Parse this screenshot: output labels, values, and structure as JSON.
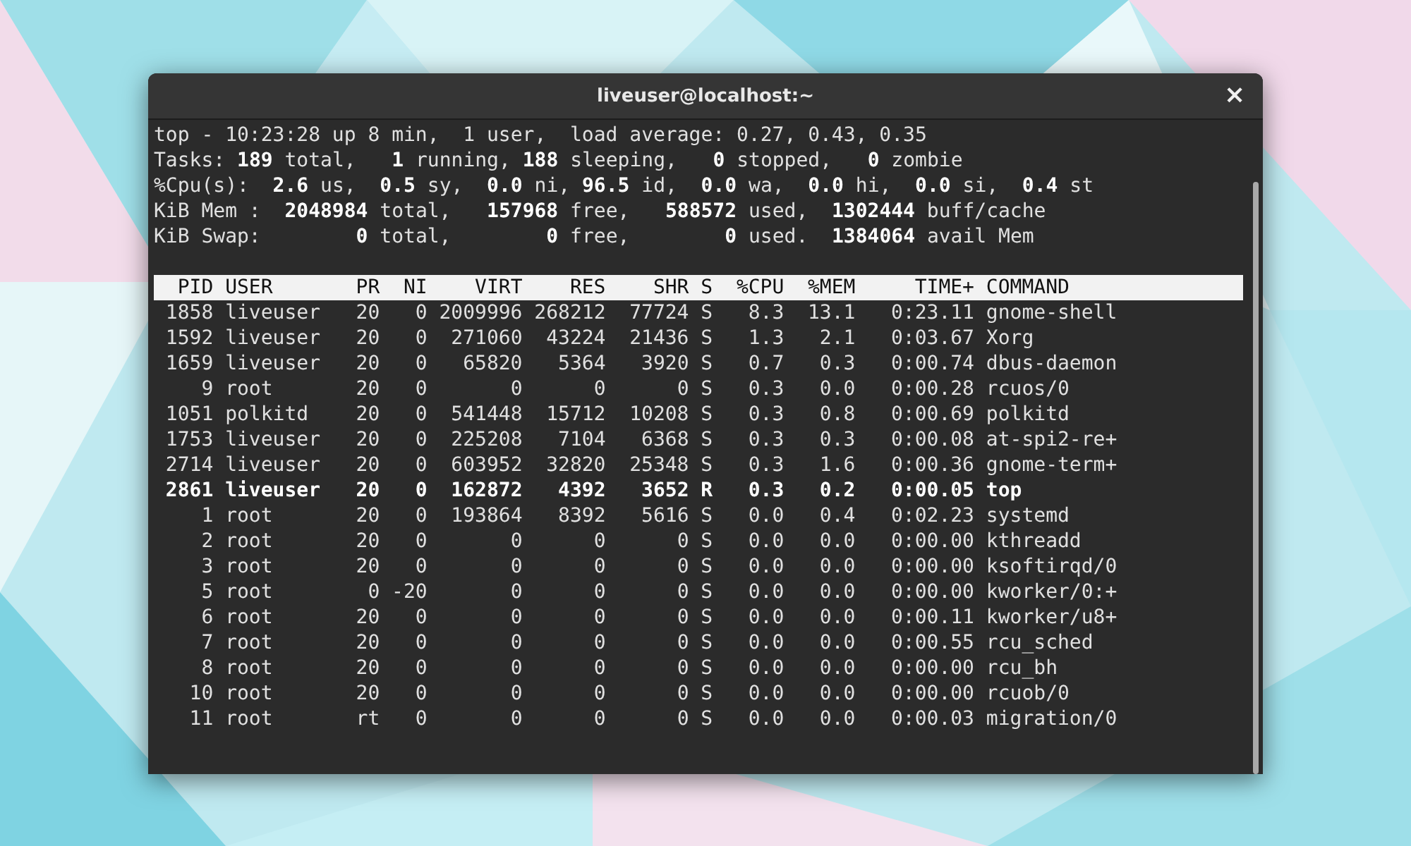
{
  "window": {
    "title": "liveuser@localhost:~",
    "close": "×"
  },
  "summary": [
    "top - 10:23:28 up 8 min,  1 user,  load average: 0.27, 0.43, 0.35",
    "Tasks: **189** total,   **1** running, **188** sleeping,   **0** stopped,   **0** zombie",
    "%Cpu(s):  **2.6** us,  **0.5** sy,  **0.0** ni, **96.5** id,  **0.0** wa,  **0.0** hi,  **0.0** si,  **0.4** st",
    "KiB Mem :  **2048984** total,   **157968** free,   **588572** used,  **1302444** buff/cache",
    "KiB Swap:        **0** total,        **0** free,        **0** used.  **1384064** avail Mem"
  ],
  "table": {
    "columns": [
      "PID",
      "USER",
      "PR",
      "NI",
      "VIRT",
      "RES",
      "SHR",
      "S",
      "%CPU",
      "%MEM",
      "TIME+",
      "COMMAND"
    ],
    "rows": [
      {
        "cells": [
          "1858",
          "liveuser",
          "20",
          "0",
          "2009996",
          "268212",
          "77724",
          "S",
          "8.3",
          "13.1",
          "0:23.11",
          "gnome-shell"
        ],
        "highlighted": false
      },
      {
        "cells": [
          "1592",
          "liveuser",
          "20",
          "0",
          "271060",
          "43224",
          "21436",
          "S",
          "1.3",
          "2.1",
          "0:03.67",
          "Xorg"
        ],
        "highlighted": false
      },
      {
        "cells": [
          "1659",
          "liveuser",
          "20",
          "0",
          "65820",
          "5364",
          "3920",
          "S",
          "0.7",
          "0.3",
          "0:00.74",
          "dbus-daemon"
        ],
        "highlighted": false
      },
      {
        "cells": [
          "9",
          "root",
          "20",
          "0",
          "0",
          "0",
          "0",
          "S",
          "0.3",
          "0.0",
          "0:00.28",
          "rcuos/0"
        ],
        "highlighted": false
      },
      {
        "cells": [
          "1051",
          "polkitd",
          "20",
          "0",
          "541448",
          "15712",
          "10208",
          "S",
          "0.3",
          "0.8",
          "0:00.69",
          "polkitd"
        ],
        "highlighted": false
      },
      {
        "cells": [
          "1753",
          "liveuser",
          "20",
          "0",
          "225208",
          "7104",
          "6368",
          "S",
          "0.3",
          "0.3",
          "0:00.08",
          "at-spi2-re+"
        ],
        "highlighted": false
      },
      {
        "cells": [
          "2714",
          "liveuser",
          "20",
          "0",
          "603952",
          "32820",
          "25348",
          "S",
          "0.3",
          "1.6",
          "0:00.36",
          "gnome-term+"
        ],
        "highlighted": false
      },
      {
        "cells": [
          "2861",
          "liveuser",
          "20",
          "0",
          "162872",
          "4392",
          "3652",
          "R",
          "0.3",
          "0.2",
          "0:00.05",
          "top"
        ],
        "highlighted": true
      },
      {
        "cells": [
          "1",
          "root",
          "20",
          "0",
          "193864",
          "8392",
          "5616",
          "S",
          "0.0",
          "0.4",
          "0:02.23",
          "systemd"
        ],
        "highlighted": false
      },
      {
        "cells": [
          "2",
          "root",
          "20",
          "0",
          "0",
          "0",
          "0",
          "S",
          "0.0",
          "0.0",
          "0:00.00",
          "kthreadd"
        ],
        "highlighted": false
      },
      {
        "cells": [
          "3",
          "root",
          "20",
          "0",
          "0",
          "0",
          "0",
          "S",
          "0.0",
          "0.0",
          "0:00.00",
          "ksoftirqd/0"
        ],
        "highlighted": false
      },
      {
        "cells": [
          "5",
          "root",
          "0",
          "-20",
          "0",
          "0",
          "0",
          "S",
          "0.0",
          "0.0",
          "0:00.00",
          "kworker/0:+"
        ],
        "highlighted": false
      },
      {
        "cells": [
          "6",
          "root",
          "20",
          "0",
          "0",
          "0",
          "0",
          "S",
          "0.0",
          "0.0",
          "0:00.11",
          "kworker/u8+"
        ],
        "highlighted": false
      },
      {
        "cells": [
          "7",
          "root",
          "20",
          "0",
          "0",
          "0",
          "0",
          "S",
          "0.0",
          "0.0",
          "0:00.55",
          "rcu_sched"
        ],
        "highlighted": false
      },
      {
        "cells": [
          "8",
          "root",
          "20",
          "0",
          "0",
          "0",
          "0",
          "S",
          "0.0",
          "0.0",
          "0:00.00",
          "rcu_bh"
        ],
        "highlighted": false
      },
      {
        "cells": [
          "10",
          "root",
          "20",
          "0",
          "0",
          "0",
          "0",
          "S",
          "0.0",
          "0.0",
          "0:00.00",
          "rcuob/0"
        ],
        "highlighted": false
      },
      {
        "cells": [
          "11",
          "root",
          "rt",
          "0",
          "0",
          "0",
          "0",
          "S",
          "0.0",
          "0.0",
          "0:00.03",
          "migration/0"
        ],
        "highlighted": false
      }
    ]
  }
}
